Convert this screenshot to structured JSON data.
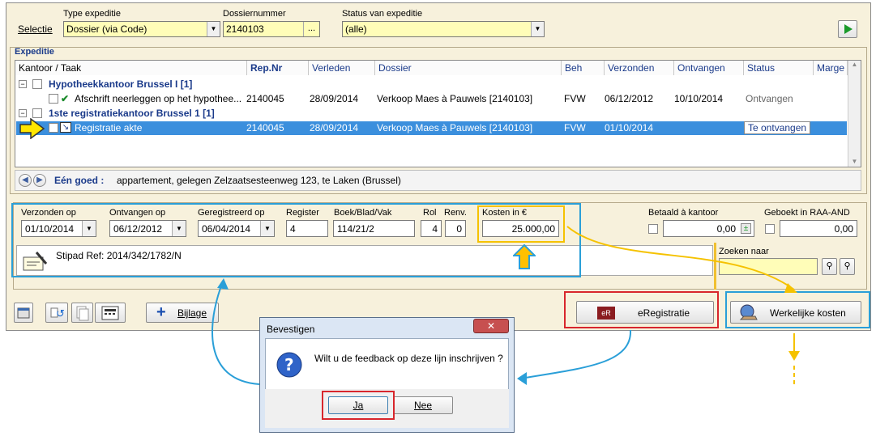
{
  "selection": {
    "label": "Selectie",
    "type_label": "Type expeditie",
    "type_value": "Dossier (via Code)",
    "dossier_label": "Dossiernummer",
    "dossier_value": "2140103",
    "dossier_btn": "...",
    "status_label": "Status van expeditie",
    "status_value": "(alle)"
  },
  "expeditie": {
    "title": "Expeditie",
    "columns": [
      "Kantoor / Taak",
      "Rep.Nr",
      "Verleden",
      "Dossier",
      "Beh",
      "Verzonden",
      "Ontvangen",
      "Status",
      "Marge"
    ],
    "group1": "Hypotheekkantoor Brussel I [1]",
    "row1": {
      "task": "Afschrift neerleggen op het hypothee...",
      "rep": "2140045",
      "verleden": "28/09/2014",
      "dossier": "Verkoop Maes à Pauwels [2140103]",
      "beh": "FVW",
      "verzonden": "06/12/2012",
      "ontvangen": "10/10/2014",
      "status": "Ontvangen"
    },
    "group2": "1ste registratiekantoor Brussel 1 [1]",
    "row2": {
      "task": "Registratie akte",
      "rep": "2140045",
      "verleden": "28/09/2014",
      "dossier": "Verkoop Maes à Pauwels [2140103]",
      "beh": "FVW",
      "verzonden": "01/10/2014",
      "status": "Te ontvangen"
    },
    "goed_label": "Eén goed :",
    "goed_value": "appartement, gelegen Zelzaatsesteenweg 123, te Laken (Brussel)"
  },
  "detail": {
    "verzonden_label": "Verzonden op",
    "verzonden_value": "01/10/2014",
    "ontvangen_label": "Ontvangen op",
    "ontvangen_value": "06/12/2012",
    "geregistreerd_label": "Geregistreerd op",
    "geregistreerd_value": "06/04/2014",
    "register_label": "Register",
    "register_value": "4",
    "boek_label": "Boek/Blad/Vak",
    "boek_value": "114/21/2",
    "rol_label": "Rol",
    "rol_value": "4",
    "renv_label": "Renv.",
    "renv_value": "0",
    "kosten_label": "Kosten in €",
    "kosten_value": "25.000,00",
    "betaald_label": "Betaald à kantoor",
    "betaald_value": "0,00",
    "geboekt_label": "Geboekt in RAA-AND",
    "geboekt_value": "0,00",
    "stipad": "Stipad Ref: 2014/342/1782/N",
    "zoeken_label": "Zoeken naar"
  },
  "toolbar": {
    "bijlage": "Bijlage",
    "eregistratie": "eRegistratie",
    "eregistratie_icon": "eR",
    "werkelijke_kosten": "Werkelijke kosten"
  },
  "dialog": {
    "title": "Bevestigen",
    "message": "Wilt u de feedback op deze lijn inschrijven ?",
    "ja": "Ja",
    "nee": "Nee"
  },
  "colors": {
    "accent_blue": "#2a9fd8",
    "highlight_yellow": "#f5c200",
    "red_box": "#d8262c",
    "selection": "#3b8fdd"
  }
}
